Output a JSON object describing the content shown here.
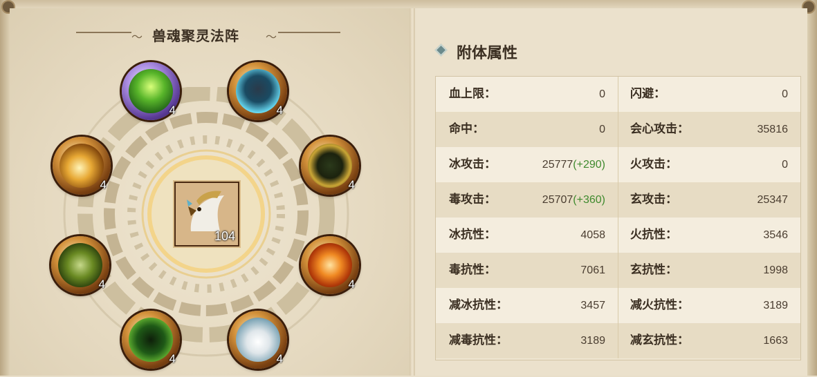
{
  "left": {
    "title": "兽魂聚灵法阵",
    "center": {
      "level": "104"
    },
    "slots": [
      {
        "level": "4",
        "icon": "green-leaf-beast-icon"
      },
      {
        "level": "4",
        "icon": "lightning-beast-icon"
      },
      {
        "level": "4",
        "icon": "golden-crest-icon"
      },
      {
        "level": "4",
        "icon": "dark-crack-beast-icon"
      },
      {
        "level": "4",
        "icon": "green-skull-icon"
      },
      {
        "level": "4",
        "icon": "fire-vortex-icon"
      },
      {
        "level": "4",
        "icon": "green-shadow-beast-icon"
      },
      {
        "level": "4",
        "icon": "snow-beast-icon"
      }
    ]
  },
  "right": {
    "title": "附体属性",
    "rows": [
      {
        "l_label": "血上限：",
        "l_value": "0",
        "l_bonus": "",
        "r_label": "闪避：",
        "r_value": "0"
      },
      {
        "l_label": "命中：",
        "l_value": "0",
        "l_bonus": "",
        "r_label": "会心攻击：",
        "r_value": "35816"
      },
      {
        "l_label": "冰攻击：",
        "l_value": "25777",
        "l_bonus": "(+290)",
        "r_label": "火攻击：",
        "r_value": "0"
      },
      {
        "l_label": "毒攻击：",
        "l_value": "25707",
        "l_bonus": "(+360)",
        "r_label": "玄攻击：",
        "r_value": "25347"
      },
      {
        "l_label": "冰抗性：",
        "l_value": "4058",
        "l_bonus": "",
        "r_label": "火抗性：",
        "r_value": "3546"
      },
      {
        "l_label": "毒抗性：",
        "l_value": "7061",
        "l_bonus": "",
        "r_label": "玄抗性：",
        "r_value": "1998"
      },
      {
        "l_label": "减冰抗性：",
        "l_value": "3457",
        "l_bonus": "",
        "r_label": "减火抗性：",
        "r_value": "3189"
      },
      {
        "l_label": "减毒抗性：",
        "l_value": "3189",
        "l_bonus": "",
        "r_label": "减玄抗性：",
        "r_value": "1663"
      }
    ]
  }
}
